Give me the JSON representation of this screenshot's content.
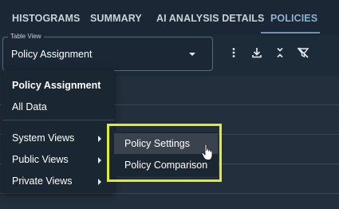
{
  "tabs": [
    {
      "label": "HISTOGRAMS"
    },
    {
      "label": "SUMMARY"
    },
    {
      "label": "AI ANALYSIS DETAILS"
    },
    {
      "label": "POLICIES",
      "active": true
    }
  ],
  "table_view": {
    "legend": "Table View",
    "value": "Policy Assignment"
  },
  "toolbar": {
    "icons": [
      "more-vert-icon",
      "download-icon",
      "collapse-icon",
      "clear-filter-icon"
    ]
  },
  "menu": {
    "items": [
      {
        "label": "Policy Assignment",
        "selected": true
      },
      {
        "label": "All Data"
      },
      {
        "label": "System Views",
        "submenu": true
      },
      {
        "label": "Public Views",
        "submenu": true
      },
      {
        "label": "Private Views",
        "submenu": true
      }
    ]
  },
  "submenu": {
    "items": [
      {
        "label": "Policy Settings",
        "hovered": true
      },
      {
        "label": "Policy Comparison"
      }
    ]
  },
  "colors": {
    "highlight": "#e3ec2a",
    "active_tab": "#8fb0cf"
  }
}
